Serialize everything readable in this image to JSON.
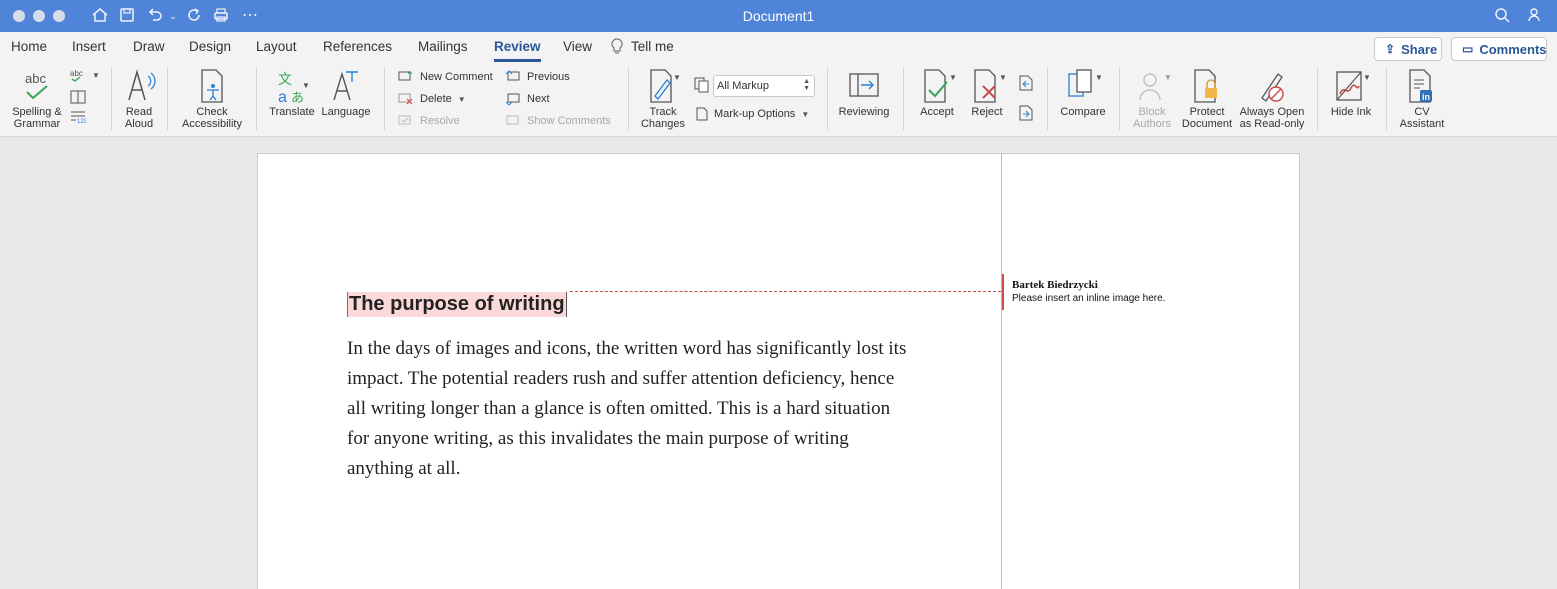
{
  "window": {
    "title": "Document1"
  },
  "tabs": [
    {
      "label": "Home"
    },
    {
      "label": "Insert"
    },
    {
      "label": "Draw"
    },
    {
      "label": "Design"
    },
    {
      "label": "Layout"
    },
    {
      "label": "References"
    },
    {
      "label": "Mailings"
    },
    {
      "label": "Review",
      "active": true
    },
    {
      "label": "View"
    }
  ],
  "tell_me": "Tell me",
  "share_label": "Share",
  "comments_label": "Comments",
  "ribbon": {
    "spelling": "Spelling &",
    "spelling2": "Grammar",
    "abc": "abc",
    "read_aloud": "Read",
    "read_aloud2": "Aloud",
    "check_access": "Check",
    "check_access2": "Accessibility",
    "translate": "Translate",
    "language": "Language",
    "new_comment": "New Comment",
    "delete": "Delete",
    "resolve": "Resolve",
    "previous": "Previous",
    "next": "Next",
    "show_comments": "Show Comments",
    "track": "Track",
    "track2": "Changes",
    "all_markup": "All Markup",
    "markup_options": "Mark-up Options",
    "reviewing": "Reviewing",
    "accept": "Accept",
    "reject": "Reject",
    "compare": "Compare",
    "block": "Block",
    "block2": "Authors",
    "protect": "Protect",
    "protect2": "Document",
    "always_open": "Always Open",
    "always_open2": "as Read-only",
    "hide_ink": "Hide Ink",
    "cv": "CV",
    "cv2": "Assistant"
  },
  "document": {
    "heading": "The purpose of writing",
    "paragraph": "In the days of images and icons, the written word has significantly lost its impact. The potential readers rush and suffer attention deficiency, hence all writing longer than a glance is often omitted. This is a hard situation for anyone writing, as this invalidates the main purpose of writing anything at all."
  },
  "comment": {
    "author": "Bartek Biedrzycki",
    "text": "Please insert an inline image here."
  },
  "colors": {
    "titlebar": "#4f84d9",
    "accent": "#2b5797",
    "markup": "#c94b4b"
  }
}
